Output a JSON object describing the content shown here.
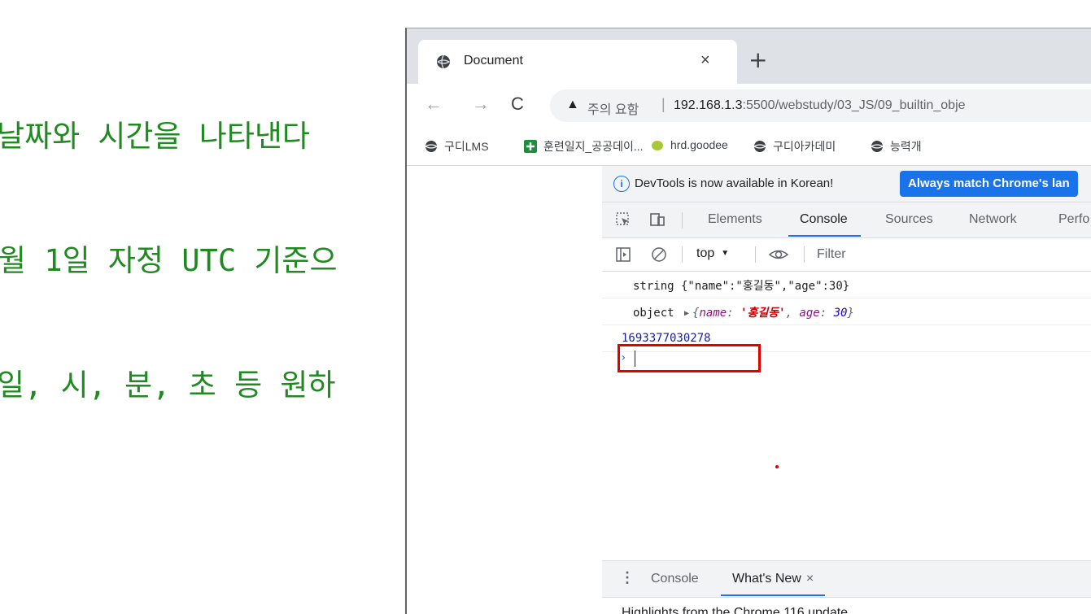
{
  "background_text": {
    "lines": [
      "날짜와 시간을 나타낸다",
      "월 1일 자정 UTC 기준으",
      "일, 시, 분, 초 등 원하"
    ]
  },
  "browser": {
    "tab": {
      "title": "Document",
      "close": "×"
    },
    "new_tab": "+",
    "nav": {
      "back": "←",
      "forward": "→",
      "reload": "C"
    },
    "omnibox": {
      "warning_icon": "▲",
      "warning_text": "주의 요함",
      "separator": "|",
      "host": "192.168.1.3",
      "path": ":5500/webstudy/03_JS/09_builtin_obje"
    },
    "bookmarks": [
      {
        "label": "구디LMS",
        "icon": "globe-icon"
      },
      {
        "label": "훈련일지_공공데이...",
        "icon": "plus-box-icon"
      },
      {
        "label": "hrd.goodee",
        "icon": "leaf-icon"
      },
      {
        "label": "구디아카데미",
        "icon": "globe-icon"
      },
      {
        "label": "능력개",
        "icon": "globe-icon"
      }
    ]
  },
  "devtools": {
    "infobar": {
      "text": "DevTools is now available in Korean!",
      "button": "Always match Chrome's lan"
    },
    "tabs": [
      "Elements",
      "Console",
      "Sources",
      "Network",
      "Perfo"
    ],
    "active_tab": "Console",
    "console_toolbar": {
      "context": "top",
      "filter_placeholder": "Filter"
    },
    "logs": [
      {
        "type": "string",
        "text": "string {\"name\":\"홍길동\",\"age\":30}"
      },
      {
        "type": "object",
        "prefix": "object",
        "key1": "name",
        "val1": "'홍길동'",
        "key2": "age",
        "val2": "30"
      },
      {
        "type": "number",
        "text": "1693377030278"
      }
    ],
    "prompt": "›",
    "drawer": {
      "tabs": [
        "Console",
        "What's New"
      ],
      "close": "×",
      "whats_new_text": "Highlights from the Chrome 116 update"
    }
  }
}
